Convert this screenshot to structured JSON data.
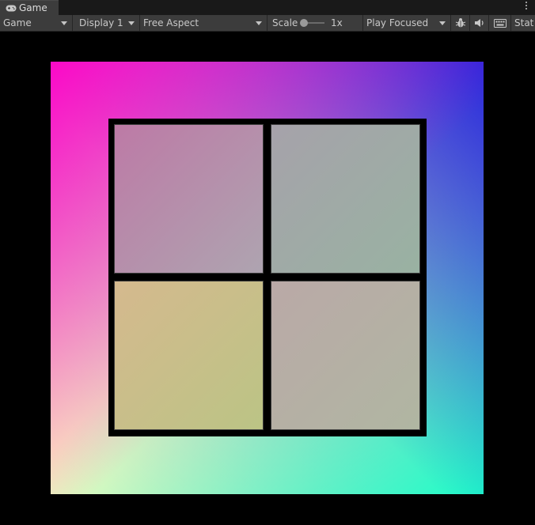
{
  "tab": {
    "label": "Game",
    "icon": "gamepad-icon"
  },
  "toolbar": {
    "view_mode": "Game",
    "display": "Display 1",
    "aspect": "Free Aspect",
    "scale_label": "Scale",
    "scale_value": "1x",
    "play_mode": "Play Focused",
    "stats_label": "Stat",
    "icons": [
      "bug-icon",
      "speaker-icon",
      "keyboard-icon"
    ]
  },
  "colors": {
    "panel": "#3c3c3c",
    "tab_strip": "#191919",
    "viewport": "#000000",
    "corner_top_left": "#ff00c8",
    "corner_top_right": "#2828dc",
    "corner_bottom_right": "#1effc8",
    "corner_bottom_left": "#ffffbe"
  }
}
